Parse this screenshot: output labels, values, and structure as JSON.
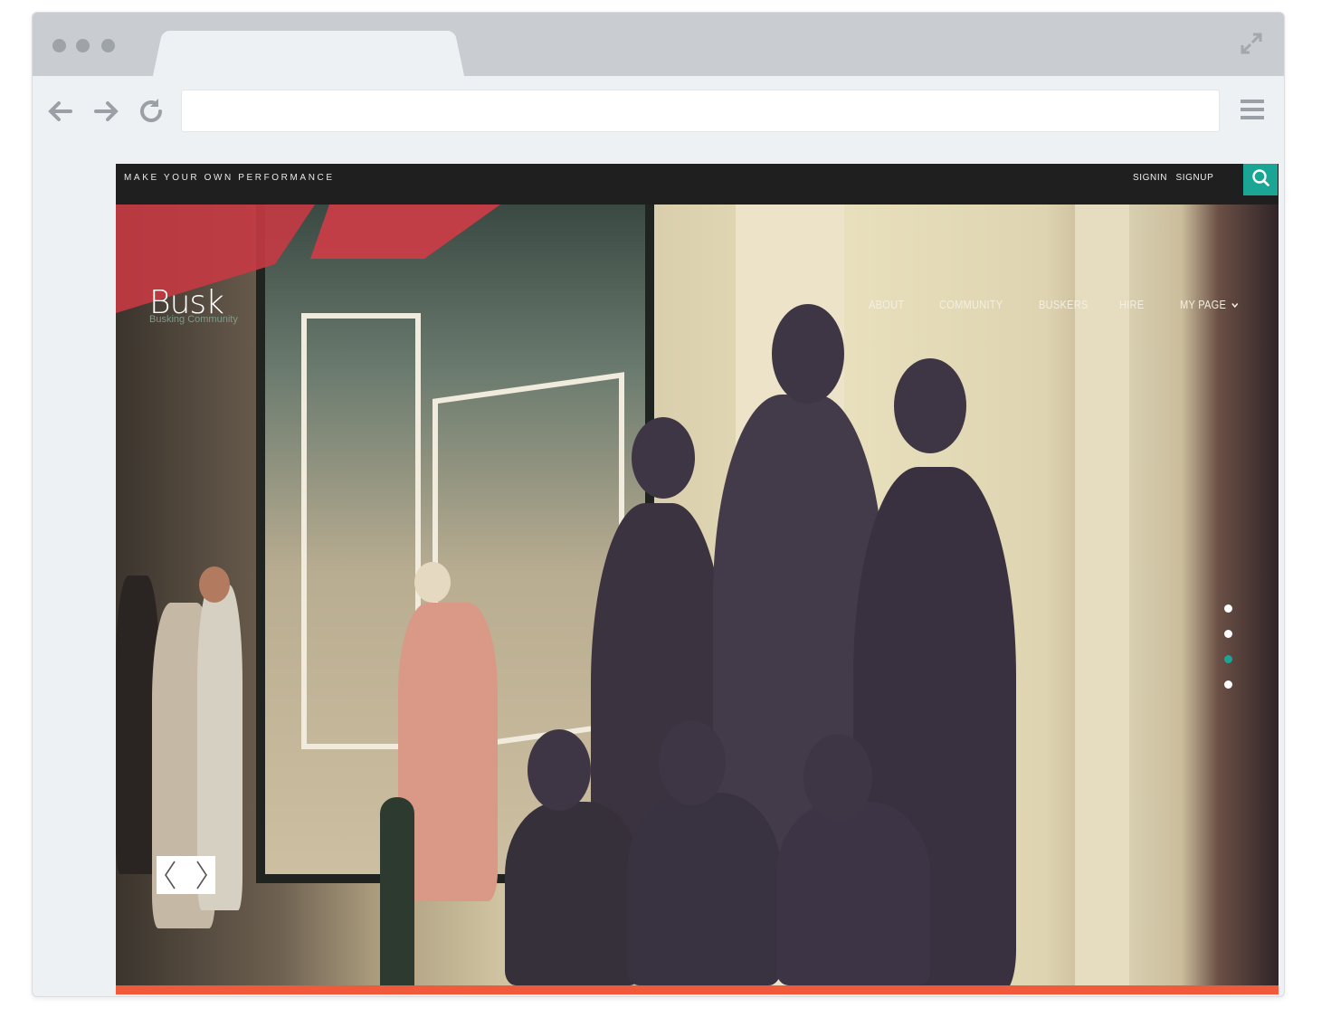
{
  "site": {
    "tagline": "MAKE YOUR OWN PERFORMANCE",
    "auth": {
      "signin": "SIGNIN",
      "signup": "SIGNUP"
    },
    "search_icon": "search-icon",
    "logo": {
      "title": "Busk",
      "subtitle": "Busking Community"
    },
    "nav": [
      {
        "label": "ABOUT"
      },
      {
        "label": "COMMUNITY"
      },
      {
        "label": "BUSKERS"
      },
      {
        "label": "HIRE"
      },
      {
        "label": "MY PAGE"
      }
    ],
    "slider": {
      "dot_count": 4,
      "active_dot": 3
    },
    "colors": {
      "topbar": "#1f1f1f",
      "accent": "#1aa595",
      "bottom_bar": "#f05a3a"
    }
  }
}
